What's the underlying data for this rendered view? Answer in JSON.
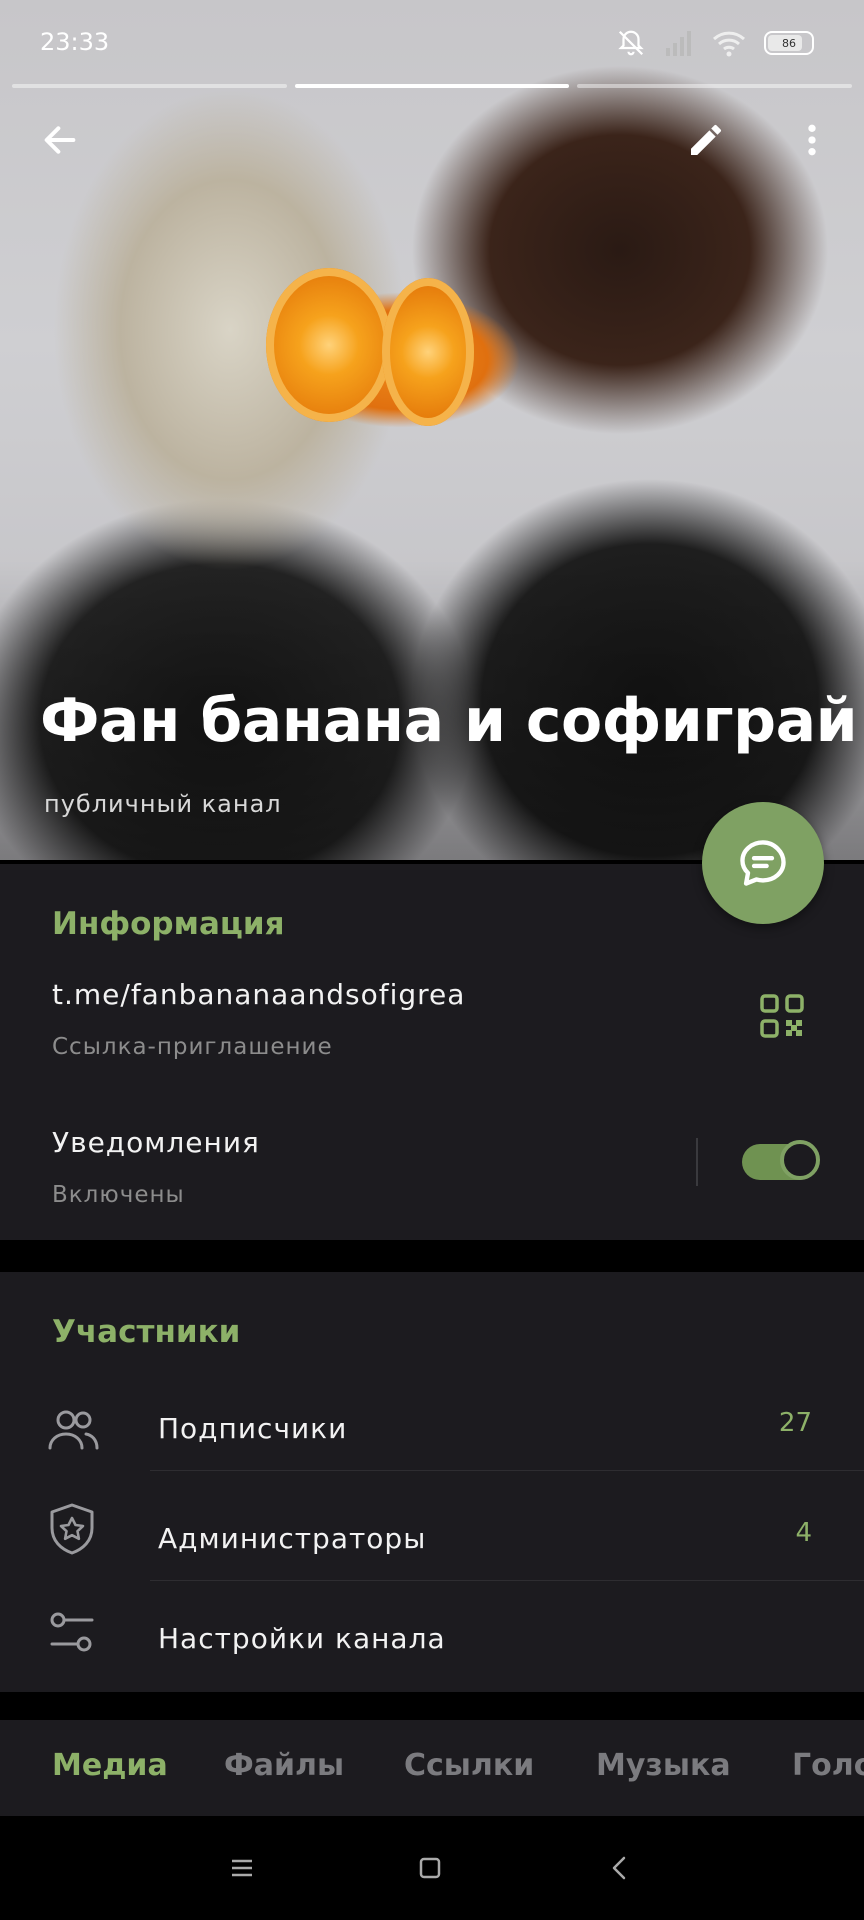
{
  "status_bar": {
    "time": "23:33",
    "battery": "86"
  },
  "header": {
    "title": "Фан банана и софиграй",
    "subtitle": "публичный канал"
  },
  "info": {
    "section_title": "Информация",
    "link": "t.me/fanbananaandsofigrea",
    "link_caption": "Ссылка-приглашение",
    "notifications_label": "Уведомления",
    "notifications_status": "Включены",
    "notifications_enabled": true
  },
  "members": {
    "section_title": "Участники",
    "items": [
      {
        "label": "Подписчики",
        "count": "27",
        "icon": "users-icon"
      },
      {
        "label": "Администраторы",
        "count": "4",
        "icon": "shield-star-icon"
      },
      {
        "label": "Настройки канала",
        "count": "",
        "icon": "sliders-icon"
      }
    ]
  },
  "tabs": [
    "Медиа",
    "Файлы",
    "Ссылки",
    "Музыка",
    "Голо"
  ],
  "colors": {
    "accent": "#8db168",
    "fab": "#7fa163",
    "panel": "#1c1b1f"
  }
}
